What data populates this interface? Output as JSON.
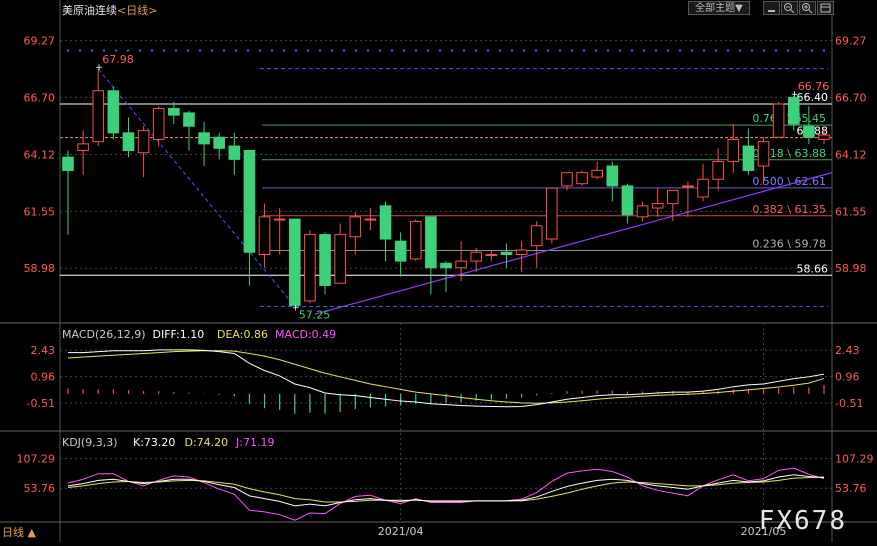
{
  "header": {
    "title": "美原油连续",
    "period_label": "<日线>",
    "board_button": "全部主题",
    "board_arrow": "▼",
    "colors": {
      "title": "#e8e8e8",
      "period": "#e0a040"
    }
  },
  "footer": {
    "period": "日线 ▲",
    "watermark": "FX678"
  },
  "colors": {
    "up": "#ff4d4d",
    "down": "#3fd17a",
    "fib": "#ffffff",
    "axis_text": "#ff5a5a",
    "grid": "#444444",
    "trend": "#8c3cff",
    "dotted_blue": "#3c5aff"
  },
  "chart_data": [
    {
      "type": "candlestick",
      "title": "美原油连续",
      "ylim": [
        57.0,
        70.2
      ],
      "y_ticks": [
        "69.27",
        "66.70",
        "64.12",
        "61.55",
        "58.98"
      ],
      "x_ticks": [
        "2021/04",
        "2021/05"
      ],
      "ohlc": [
        [
          64.0,
          63.4,
          60.5,
          64.3
        ],
        [
          64.3,
          64.6,
          63.2,
          65.2
        ],
        [
          64.7,
          67.0,
          64.5,
          67.98
        ],
        [
          67.0,
          65.1,
          64.8,
          67.2
        ],
        [
          65.1,
          64.3,
          64.0,
          65.8
        ],
        [
          64.2,
          65.2,
          63.1,
          65.4
        ],
        [
          64.8,
          66.2,
          64.5,
          66.3
        ],
        [
          66.2,
          65.9,
          65.5,
          66.5
        ],
        [
          66.0,
          65.4,
          64.3,
          66.1
        ],
        [
          65.1,
          64.6,
          63.6,
          65.6
        ],
        [
          64.9,
          64.4,
          63.9,
          65.1
        ],
        [
          64.5,
          63.9,
          63.2,
          65.1
        ],
        [
          64.3,
          59.7,
          58.2,
          64.3
        ],
        [
          59.6,
          61.3,
          59.0,
          61.9
        ],
        [
          61.2,
          61.2,
          59.6,
          61.7
        ],
        [
          61.2,
          57.3,
          57.25,
          61.2
        ],
        [
          57.5,
          60.5,
          57.4,
          60.7
        ],
        [
          60.5,
          58.2,
          57.8,
          60.6
        ],
        [
          58.3,
          60.5,
          58.3,
          61.0
        ],
        [
          60.4,
          61.3,
          59.6,
          61.5
        ],
        [
          61.2,
          61.2,
          60.7,
          61.7
        ],
        [
          61.8,
          60.3,
          59.3,
          62.0
        ],
        [
          60.2,
          59.3,
          58.6,
          60.6
        ],
        [
          59.4,
          61.1,
          59.3,
          61.2
        ],
        [
          61.3,
          59.0,
          57.8,
          61.3
        ],
        [
          59.2,
          59.0,
          57.9,
          59.3
        ],
        [
          59.0,
          59.3,
          58.4,
          60.2
        ],
        [
          59.3,
          59.7,
          58.8,
          59.9
        ],
        [
          59.6,
          59.6,
          59.3,
          59.8
        ],
        [
          59.7,
          59.6,
          59.0,
          60.1
        ],
        [
          59.6,
          59.8,
          58.8,
          60.2
        ],
        [
          60.0,
          60.9,
          59.0,
          61.1
        ],
        [
          60.3,
          62.6,
          60.1,
          62.6
        ],
        [
          62.7,
          63.3,
          62.5,
          63.3
        ],
        [
          62.8,
          63.3,
          62.7,
          63.4
        ],
        [
          63.1,
          63.4,
          63.0,
          63.8
        ],
        [
          63.6,
          62.7,
          62.0,
          63.8
        ],
        [
          62.7,
          61.4,
          61.0,
          62.8
        ],
        [
          61.3,
          61.8,
          61.1,
          62.0
        ],
        [
          61.7,
          61.9,
          61.3,
          62.6
        ],
        [
          61.9,
          62.5,
          61.1,
          62.5
        ],
        [
          62.7,
          62.7,
          61.3,
          62.9
        ],
        [
          62.2,
          63.0,
          62.0,
          63.7
        ],
        [
          63.0,
          63.8,
          62.5,
          64.4
        ],
        [
          63.8,
          64.8,
          63.3,
          65.5
        ],
        [
          64.5,
          63.4,
          63.2,
          65.3
        ],
        [
          63.6,
          64.7,
          62.8,
          64.9
        ],
        [
          64.9,
          66.4,
          64.9,
          66.5
        ],
        [
          66.7,
          65.5,
          65.2,
          66.76
        ],
        [
          65.4,
          64.9,
          64.6,
          66.3
        ],
        [
          64.8,
          65.0,
          64.6,
          65.3
        ]
      ],
      "fib_levels": [
        {
          "ratio": "0.764",
          "value": 65.45,
          "label": "0.764 \\ 65.45",
          "color": "#3fd17a"
        },
        {
          "ratio": "0.618",
          "value": 63.88,
          "label": "0.618 \\ 63.88",
          "color": "#3fd17a"
        },
        {
          "ratio": "0.500",
          "value": 62.61,
          "label": "0.500 \\ 62.61",
          "color": "#7d7dff"
        },
        {
          "ratio": "0.382",
          "value": 61.35,
          "label": "0.382 \\ 61.35",
          "color": "#ff5a5a"
        },
        {
          "ratio": "0.236",
          "value": 59.78,
          "label": "0.236 \\ 59.78",
          "color": "#b4b4b4"
        }
      ],
      "h_lines": [
        {
          "value": 66.4,
          "label": "66.40",
          "color": "#ffffff"
        },
        {
          "value": 64.88,
          "label": "64.88",
          "color": "#ffffff"
        },
        {
          "value": 58.66,
          "label": "58.66",
          "color": "#ffffff"
        }
      ],
      "annotations": [
        {
          "label": "67.98",
          "value": 67.98,
          "index": 2,
          "color": "#ff5a5a"
        },
        {
          "label": "57.25",
          "value": 57.25,
          "index": 15,
          "color": "#3fd17a"
        },
        {
          "label": "66.76",
          "value": 66.76,
          "index": 48,
          "color": "#ff5a5a"
        }
      ]
    },
    {
      "type": "macd",
      "title": "MACD(26,12,9)",
      "legend": [
        {
          "text": "MACD(26,12,9)",
          "color": "#cccccc"
        },
        {
          "text": "DIFF:1.10",
          "color": "#ffffff"
        },
        {
          "text": "DEA:0.86",
          "color": "#e6e64d"
        },
        {
          "text": "MACD:0.49",
          "color": "#ff55ff"
        }
      ],
      "ylim": [
        -1.9,
        3.0
      ],
      "y_ticks": [
        "2.43",
        "0.96",
        "-0.51"
      ],
      "diff": [
        2.3,
        2.3,
        2.35,
        2.4,
        2.4,
        2.4,
        2.45,
        2.45,
        2.45,
        2.42,
        2.35,
        2.25,
        1.7,
        1.3,
        1.0,
        0.55,
        0.35,
        0.05,
        -0.05,
        -0.1,
        -0.2,
        -0.3,
        -0.4,
        -0.45,
        -0.55,
        -0.6,
        -0.65,
        -0.68,
        -0.7,
        -0.72,
        -0.7,
        -0.6,
        -0.45,
        -0.3,
        -0.2,
        -0.1,
        -0.05,
        -0.05,
        0.0,
        0.05,
        0.1,
        0.1,
        0.15,
        0.25,
        0.4,
        0.5,
        0.55,
        0.7,
        0.85,
        0.95,
        1.1
      ],
      "dea": [
        2.0,
        2.05,
        2.1,
        2.15,
        2.2,
        2.25,
        2.3,
        2.35,
        2.38,
        2.4,
        2.4,
        2.38,
        2.25,
        2.1,
        1.9,
        1.65,
        1.4,
        1.15,
        0.95,
        0.75,
        0.55,
        0.4,
        0.25,
        0.1,
        0.0,
        -0.1,
        -0.2,
        -0.3,
        -0.38,
        -0.45,
        -0.5,
        -0.52,
        -0.5,
        -0.45,
        -0.38,
        -0.3,
        -0.23,
        -0.18,
        -0.13,
        -0.08,
        -0.05,
        -0.02,
        0.02,
        0.08,
        0.15,
        0.22,
        0.3,
        0.38,
        0.48,
        0.6,
        0.86
      ],
      "hist": [
        0.3,
        0.25,
        0.25,
        0.25,
        0.2,
        0.15,
        0.15,
        0.1,
        0.07,
        0.02,
        -0.05,
        -0.13,
        -0.55,
        -0.8,
        -0.9,
        -1.1,
        -1.05,
        -1.1,
        -1.0,
        -0.85,
        -0.75,
        -0.7,
        -0.65,
        -0.55,
        -0.55,
        -0.5,
        -0.45,
        -0.38,
        -0.32,
        -0.27,
        -0.2,
        -0.08,
        0.05,
        0.15,
        0.18,
        0.2,
        0.18,
        0.13,
        0.13,
        0.13,
        0.15,
        0.12,
        0.13,
        0.17,
        0.25,
        0.28,
        0.25,
        0.32,
        0.37,
        0.35,
        0.49
      ]
    },
    {
      "type": "kdj",
      "title": "KDJ(9,3,3)",
      "legend": [
        {
          "text": "KDJ(9,3,3)",
          "color": "#cccccc"
        },
        {
          "text": "K:73.20",
          "color": "#ffffff"
        },
        {
          "text": "D:74.20",
          "color": "#e6e64d"
        },
        {
          "text": "J:71.19",
          "color": "#ff55ff"
        }
      ],
      "ylim": [
        0,
        130
      ],
      "y_ticks": [
        "107.29",
        "53.76"
      ],
      "k": [
        58,
        62,
        68,
        70,
        66,
        62,
        66,
        70,
        70,
        66,
        60,
        55,
        40,
        35,
        30,
        22,
        25,
        22,
        28,
        33,
        35,
        32,
        30,
        33,
        30,
        30,
        30,
        31,
        31,
        31,
        32,
        38,
        48,
        57,
        63,
        68,
        70,
        68,
        62,
        58,
        55,
        52,
        58,
        63,
        68,
        65,
        67,
        74,
        78,
        75,
        73
      ],
      "d": [
        55,
        58,
        62,
        65,
        66,
        64,
        65,
        67,
        68,
        67,
        64,
        61,
        53,
        47,
        42,
        35,
        33,
        29,
        29,
        30,
        32,
        32,
        32,
        32,
        31,
        31,
        31,
        31,
        31,
        31,
        31,
        34,
        39,
        45,
        52,
        58,
        63,
        65,
        64,
        62,
        60,
        58,
        58,
        60,
        63,
        64,
        65,
        68,
        72,
        73,
        74
      ],
      "j": [
        63,
        70,
        80,
        80,
        66,
        58,
        68,
        76,
        74,
        64,
        52,
        43,
        14,
        11,
        6,
        -4,
        9,
        8,
        26,
        39,
        41,
        32,
        26,
        35,
        28,
        28,
        28,
        31,
        31,
        31,
        34,
        46,
        66,
        81,
        85,
        88,
        84,
        74,
        58,
        50,
        45,
        40,
        58,
        69,
        78,
        67,
        71,
        86,
        90,
        79,
        71
      ]
    }
  ]
}
